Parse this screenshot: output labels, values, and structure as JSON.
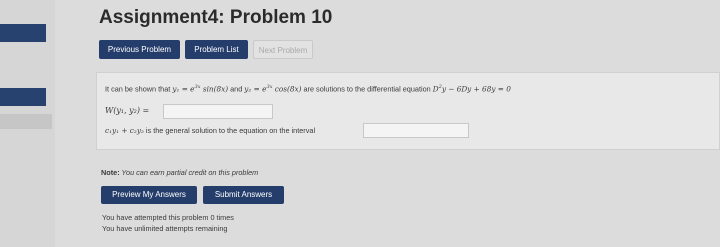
{
  "page": {
    "title": "Assignment4: Problem 10"
  },
  "nav": {
    "previous": "Previous Problem",
    "list": "Problem List",
    "next": "Next Problem"
  },
  "problem": {
    "intro": "It can be shown that",
    "y1_name": "y₁",
    "eq1": " = e",
    "exp1": "3x",
    "y1_rest": " sin(8x)",
    "and_text": " and ",
    "y2_name": "y₂",
    "eq2": " = e",
    "exp2": "3x",
    "y2_rest": " cos(8x)",
    "are_text": " are solutions to the differential equation ",
    "de_lhs": "D",
    "de_sup": "2",
    "de_rest": "y − 6Dy + 68y = 0",
    "wronskian": "W(y₁, y₂) =",
    "wronskian_value": "",
    "general_solution_math": "c₁y₁ + c₂y₂",
    "general_solution_text": " is the general solution to the equation on the interval",
    "interval_value": ""
  },
  "note": {
    "label": "Note:",
    "text": " You can earn partial credit on this problem"
  },
  "actions": {
    "preview": "Preview My Answers",
    "submit": "Submit Answers"
  },
  "status": {
    "attempts": "You have attempted this problem 0 times",
    "remaining": "You have unlimited attempts remaining"
  },
  "colors": {
    "accent": "#243d6b",
    "background": "#dcdcdc"
  }
}
